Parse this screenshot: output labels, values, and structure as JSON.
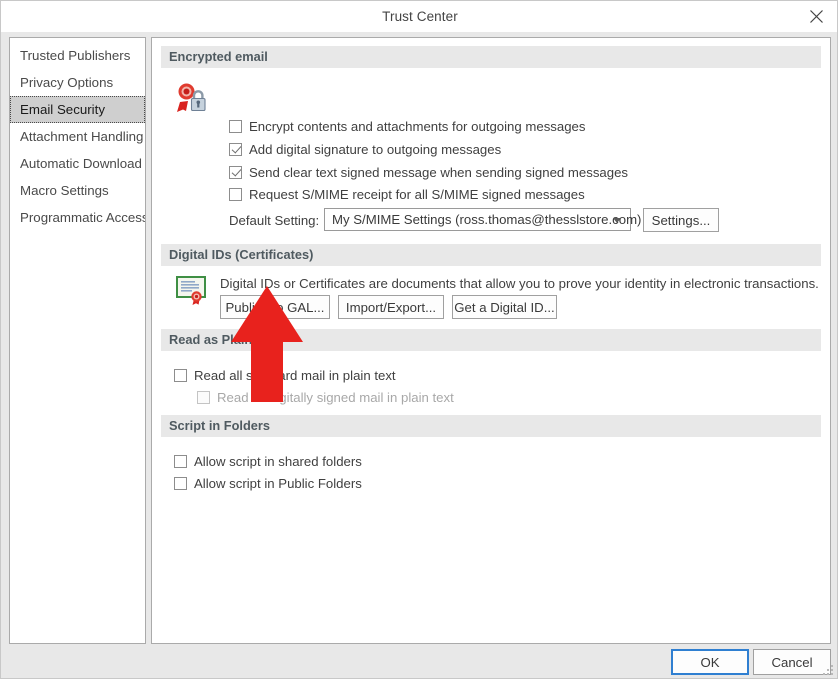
{
  "window": {
    "title": "Trust Center",
    "close_icon": "close-icon"
  },
  "sidebar": {
    "items": [
      {
        "label": "Trusted Publishers",
        "selected": false
      },
      {
        "label": "Privacy Options",
        "selected": false
      },
      {
        "label": "Email Security",
        "selected": true
      },
      {
        "label": "Attachment Handling",
        "selected": false
      },
      {
        "label": "Automatic Download",
        "selected": false
      },
      {
        "label": "Macro Settings",
        "selected": false
      },
      {
        "label": "Programmatic Access",
        "selected": false
      }
    ]
  },
  "sections": {
    "encrypted_email": {
      "header": "Encrypted email",
      "icon": "certificate-lock-icon",
      "checkboxes": [
        {
          "label": "Encrypt contents and attachments for outgoing messages",
          "checked": false,
          "accel": "E"
        },
        {
          "label": "Add digital signature to outgoing messages",
          "checked": true,
          "accel": "dd"
        },
        {
          "label": "Send clear text signed message when sending signed messages",
          "checked": true,
          "accel": "t"
        },
        {
          "label": "Request S/MIME receipt for all S/MIME signed messages",
          "checked": false,
          "accel": "R"
        }
      ],
      "default_setting_label": "Default Setting:",
      "default_setting_value": "My S/MIME Settings (ross.thomas@thesslstore.com)",
      "settings_button": "Settings..."
    },
    "digital_ids": {
      "header": "Digital IDs (Certificates)",
      "icon": "certificate-document-icon",
      "description": "Digital IDs or Certificates are documents that allow you to prove your identity in electronic transactions.",
      "buttons": [
        {
          "label": "Publish to GAL..."
        },
        {
          "label": "Import/Export..."
        },
        {
          "label": "Get a Digital ID..."
        }
      ]
    },
    "read_as_plain_text": {
      "header": "Read as Plain Text",
      "checkboxes": [
        {
          "label": "Read all standard mail in plain text",
          "checked": false,
          "disabled": false
        },
        {
          "label": "Read all digitally signed mail in plain text",
          "checked": false,
          "disabled": true
        }
      ]
    },
    "script_in_folders": {
      "header": "Script in Folders",
      "checkboxes": [
        {
          "label": "Allow script in shared folders",
          "checked": false
        },
        {
          "label": "Allow script in Public Folders",
          "checked": false
        }
      ]
    }
  },
  "footer": {
    "ok_label": "OK",
    "cancel_label": "Cancel"
  },
  "annotation": {
    "type": "red-arrow-up",
    "color": "#e8221d",
    "points_to": "Publish to GAL..."
  }
}
